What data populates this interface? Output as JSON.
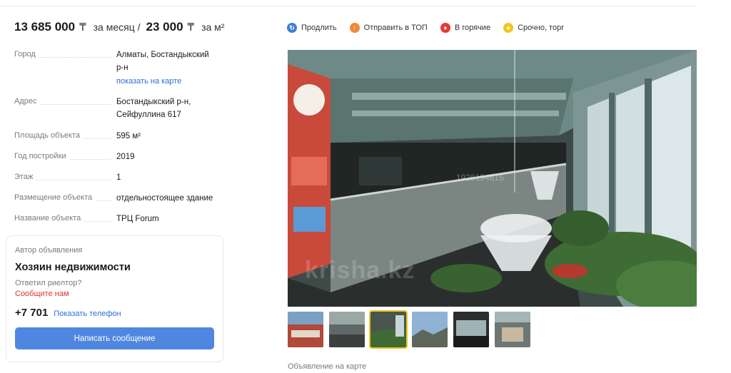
{
  "price": {
    "monthly_amount": "13 685 000",
    "currency": "₸",
    "monthly_unit": "за месяц /",
    "per_m2_amount": "23 000",
    "per_m2_unit": "за м²"
  },
  "props": [
    {
      "label": "Город",
      "value": "Алматы, Бостандыкский р-н",
      "link": "показать на карте"
    },
    {
      "label": "Адрес",
      "value": "Бостандыкский р-н, Сейфуллина 617"
    },
    {
      "label": "Площадь объекта",
      "value": "595 м²"
    },
    {
      "label": "Год постройки",
      "value": "2019"
    },
    {
      "label": "Этаж",
      "value": "1"
    },
    {
      "label": "Размещение объекта",
      "value": "отдельностоящее здание"
    },
    {
      "label": "Название объекта",
      "value": "ТРЦ Forum"
    }
  ],
  "author": {
    "caption": "Автор объявления",
    "name": "Хозяин недвижимости",
    "realtor_question": "Ответил риелтор?",
    "report_link": "Сообщите нам",
    "phone": "+7 701",
    "show_phone": "Показать телефон",
    "message_button": "Написать сообщение"
  },
  "actions": [
    {
      "label": "Продлить",
      "icon": "refresh-icon",
      "color": "#3d7fd8"
    },
    {
      "label": "Отправить в ТОП",
      "icon": "arrow-up-icon",
      "color": "#f0883a"
    },
    {
      "label": "В горячие",
      "icon": "fire-icon",
      "color": "#e53b2f"
    },
    {
      "label": "Срочно, торг",
      "icon": "tag-icon",
      "color": "#f3c51c"
    }
  ],
  "photo": {
    "watermark": "krisha.kz",
    "photo_id": "1926154615"
  },
  "thumbnails_count": 6,
  "active_thumbnail": 3,
  "map_caption": "Объявление на карте"
}
